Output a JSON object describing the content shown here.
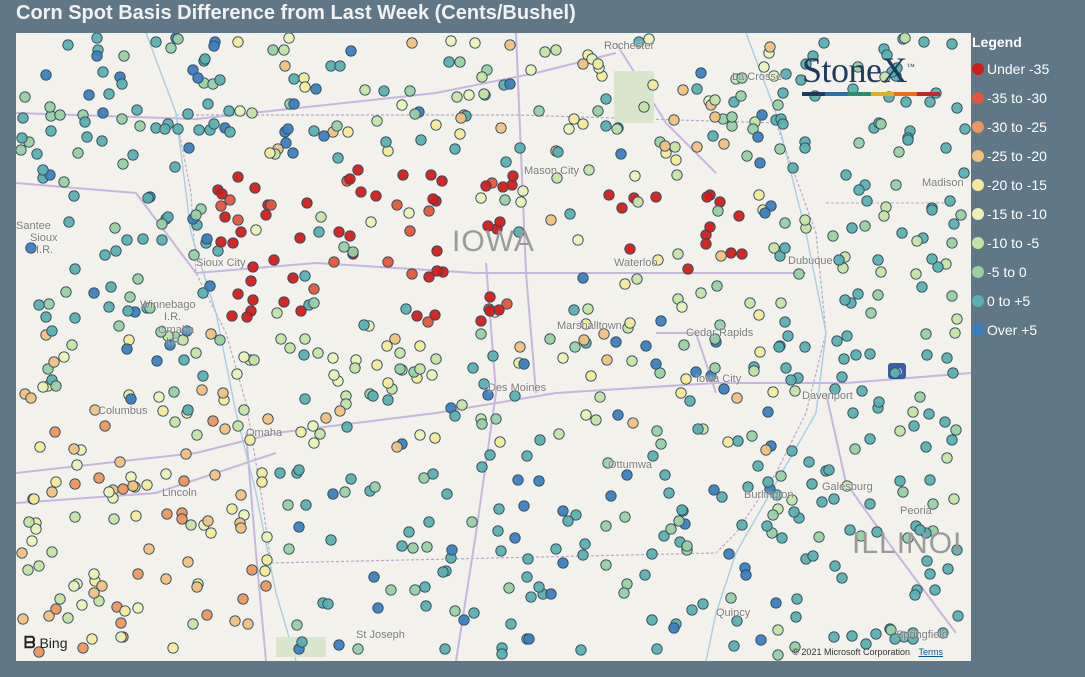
{
  "title": "Corn Spot Basis Difference from Last Week (Cents/Bushel)",
  "legend": {
    "title": "Legend",
    "items": [
      {
        "label": "Under -35",
        "color": "#d21c1c"
      },
      {
        "label": "-35 to -30",
        "color": "#e4563b"
      },
      {
        "label": "-30 to -25",
        "color": "#ec955d"
      },
      {
        "label": "-25 to -20",
        "color": "#f1c07f"
      },
      {
        "label": "-20 to -15",
        "color": "#f3ea9a"
      },
      {
        "label": "-15 to -10",
        "color": "#eaf2b8"
      },
      {
        "label": "-10 to -5",
        "color": "#c6e2a5"
      },
      {
        "label": "-5 to 0",
        "color": "#99cfa3"
      },
      {
        "label": "0 to +5",
        "color": "#5aafb0"
      },
      {
        "label": "Over +5",
        "color": "#3b7fc0"
      }
    ]
  },
  "logo": {
    "text": "StoneX",
    "tm": "™",
    "bar_colors": [
      "#1f3a5f",
      "#2f6fa6",
      "#2d8f6a",
      "#e0b020",
      "#e86e1a",
      "#c0282d"
    ]
  },
  "map": {
    "state_labels": {
      "iowa": "IOWA",
      "illinois": "ILLINOI"
    },
    "cities": [
      {
        "key": "rochester",
        "name": "Rochester"
      },
      {
        "key": "lacrosse",
        "name": "La Crosse"
      },
      {
        "key": "mason_city",
        "name": "Mason City"
      },
      {
        "key": "madison",
        "name": "Madison"
      },
      {
        "key": "santee",
        "name": "Santee"
      },
      {
        "key": "sioux_ir",
        "name": "Sioux"
      },
      {
        "key": "ir1",
        "name": "I.R."
      },
      {
        "key": "sioux_city",
        "name": "Sioux City"
      },
      {
        "key": "waterloo",
        "name": "Waterloo"
      },
      {
        "key": "dubuque",
        "name": "Dubuque"
      },
      {
        "key": "winnebago",
        "name": "Winnebago"
      },
      {
        "key": "ir2",
        "name": "I.R."
      },
      {
        "key": "omaha_ir",
        "name": "Omaha"
      },
      {
        "key": "ir3",
        "name": "I.R."
      },
      {
        "key": "marshalltown",
        "name": "Marshalltown"
      },
      {
        "key": "cedar_rapids",
        "name": "Cedar Rapids"
      },
      {
        "key": "iowa_city",
        "name": "Iowa City"
      },
      {
        "key": "des_moines",
        "name": "Des Moines"
      },
      {
        "key": "davenport",
        "name": "Davenport"
      },
      {
        "key": "columbus",
        "name": "Columbus"
      },
      {
        "key": "omaha",
        "name": "Omaha"
      },
      {
        "key": "ottumwa",
        "name": "Ottumwa"
      },
      {
        "key": "galesburg",
        "name": "Galesburg"
      },
      {
        "key": "lincoln",
        "name": "Lincoln"
      },
      {
        "key": "burlington",
        "name": "Burlington"
      },
      {
        "key": "peoria",
        "name": "Peoria"
      },
      {
        "key": "st_joseph",
        "name": "St Joseph"
      },
      {
        "key": "quincy",
        "name": "Quincy"
      },
      {
        "key": "springfield",
        "name": "Springfield"
      }
    ],
    "interstate_shield": "80",
    "bing": "Bing",
    "copyright": "© 2021 Microsoft Corporation",
    "terms": "Terms"
  }
}
